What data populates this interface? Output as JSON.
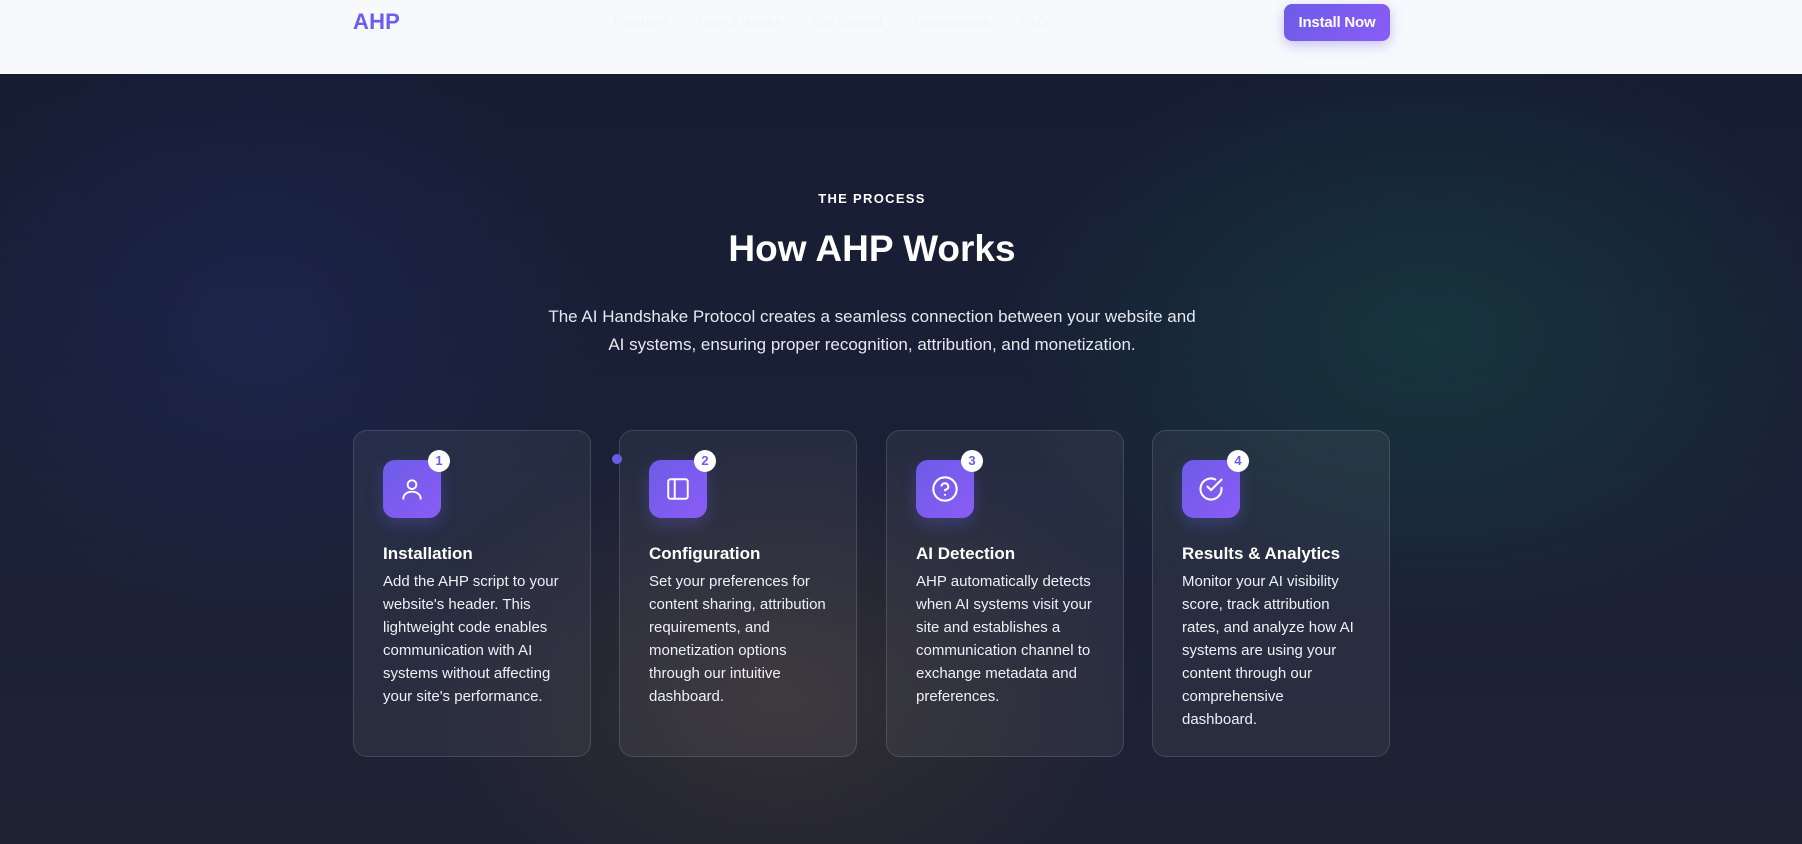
{
  "header": {
    "logo": "AHP",
    "nav": [
      "Features",
      "How It Works",
      "Get Started",
      "Testimonials",
      "FAQ"
    ],
    "cta": "Install Now"
  },
  "section": {
    "eyebrow": "THE PROCESS",
    "title": "How AHP Works",
    "subtitle": "The AI Handshake Protocol creates a seamless connection between your website and AI systems, ensuring proper recognition, attribution, and monetization."
  },
  "steps": [
    {
      "number": "1",
      "icon": "user-icon",
      "title": "Installation",
      "description": "Add the AHP script to your website's header. This lightweight code enables communication with AI systems without affecting your site's performance."
    },
    {
      "number": "2",
      "icon": "panel-icon",
      "title": "Configuration",
      "description": "Set your preferences for content sharing, attribution requirements, and monetization options through our intuitive dashboard."
    },
    {
      "number": "3",
      "icon": "question-circle-icon",
      "title": "AI Detection",
      "description": "AHP automatically detects when AI systems visit your site and establishes a communication channel to exchange metadata and preferences."
    },
    {
      "number": "4",
      "icon": "check-circle-icon",
      "title": "Results & Analytics",
      "description": "Monitor your AI visibility score, track attribution rates, and analyze how AI systems are using your content through our comprehensive dashboard."
    }
  ],
  "colors": {
    "accent": "#6c5ce7",
    "header_bg": "#f8f9fc",
    "section_bg": "#161c33"
  }
}
